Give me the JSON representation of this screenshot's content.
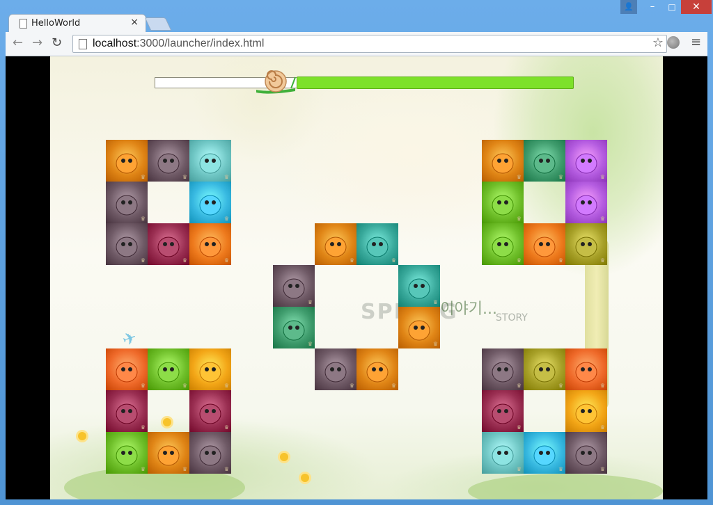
{
  "browser": {
    "tab_title": "HelloWorld",
    "tab_close": "×",
    "url_host": "localhost",
    "url_rest": ":3000/launcher/index.html"
  },
  "window_controls": {
    "user": "👤",
    "minimize": "–",
    "maximize": "□",
    "close": "✕"
  },
  "nav": {
    "back": "←",
    "forward": "→",
    "reload": "↻",
    "bookmark": "☆",
    "menu": "≡"
  },
  "game": {
    "progress_fraction": 0.66,
    "watermark": "SPRING",
    "watermark_script": "봄이야기...",
    "watermark_small": "STORY",
    "tile_colors": {
      "duck": "#e08516",
      "spider": "#6f5a66",
      "bear": "#6fc6c4",
      "blueblob": "#38b9e1",
      "beet": "#9a2f52",
      "pumpkin": "#ee7a1d",
      "fish": "#39a99b",
      "dragon": "#3f9c6d",
      "octopus": "#b45ce0",
      "sprout": "#6fbf2a",
      "slug": "#a7a028",
      "fox": "#ef6a2a",
      "sunny": "#f3a617"
    },
    "tiles": [
      {
        "row": 0,
        "col": 0,
        "kind": "duck"
      },
      {
        "row": 0,
        "col": 1,
        "kind": "spider"
      },
      {
        "row": 0,
        "col": 2,
        "kind": "bear"
      },
      {
        "row": 1,
        "col": 0,
        "kind": "spider"
      },
      {
        "row": 1,
        "col": 2,
        "kind": "blueblob"
      },
      {
        "row": 2,
        "col": 0,
        "kind": "spider"
      },
      {
        "row": 2,
        "col": 1,
        "kind": "beet"
      },
      {
        "row": 2,
        "col": 2,
        "kind": "pumpkin"
      },
      {
        "row": 2,
        "col": 5,
        "kind": "duck"
      },
      {
        "row": 2,
        "col": 6,
        "kind": "fish"
      },
      {
        "row": 3,
        "col": 4,
        "kind": "spider"
      },
      {
        "row": 3,
        "col": 7,
        "kind": "fish"
      },
      {
        "row": 4,
        "col": 4,
        "kind": "dragon"
      },
      {
        "row": 4,
        "col": 7,
        "kind": "duck"
      },
      {
        "row": 5,
        "col": 5,
        "kind": "spider"
      },
      {
        "row": 5,
        "col": 6,
        "kind": "duck"
      },
      {
        "row": 0,
        "col": 9,
        "kind": "duck"
      },
      {
        "row": 0,
        "col": 10,
        "kind": "dragon"
      },
      {
        "row": 0,
        "col": 11,
        "kind": "octopus"
      },
      {
        "row": 1,
        "col": 9,
        "kind": "sprout"
      },
      {
        "row": 1,
        "col": 11,
        "kind": "octopus"
      },
      {
        "row": 2,
        "col": 9,
        "kind": "sprout"
      },
      {
        "row": 2,
        "col": 10,
        "kind": "pumpkin"
      },
      {
        "row": 2,
        "col": 11,
        "kind": "slug"
      },
      {
        "row": 5,
        "col": 0,
        "kind": "fox"
      },
      {
        "row": 5,
        "col": 1,
        "kind": "sprout"
      },
      {
        "row": 5,
        "col": 2,
        "kind": "sunny"
      },
      {
        "row": 6,
        "col": 0,
        "kind": "beet"
      },
      {
        "row": 6,
        "col": 2,
        "kind": "beet"
      },
      {
        "row": 7,
        "col": 0,
        "kind": "sprout"
      },
      {
        "row": 7,
        "col": 1,
        "kind": "duck"
      },
      {
        "row": 7,
        "col": 2,
        "kind": "spider"
      },
      {
        "row": 5,
        "col": 9,
        "kind": "spider"
      },
      {
        "row": 5,
        "col": 10,
        "kind": "slug"
      },
      {
        "row": 5,
        "col": 11,
        "kind": "fox"
      },
      {
        "row": 6,
        "col": 9,
        "kind": "beet"
      },
      {
        "row": 6,
        "col": 11,
        "kind": "sunny"
      },
      {
        "row": 7,
        "col": 9,
        "kind": "bear"
      },
      {
        "row": 7,
        "col": 10,
        "kind": "blueblob"
      },
      {
        "row": 7,
        "col": 11,
        "kind": "spider"
      }
    ]
  }
}
